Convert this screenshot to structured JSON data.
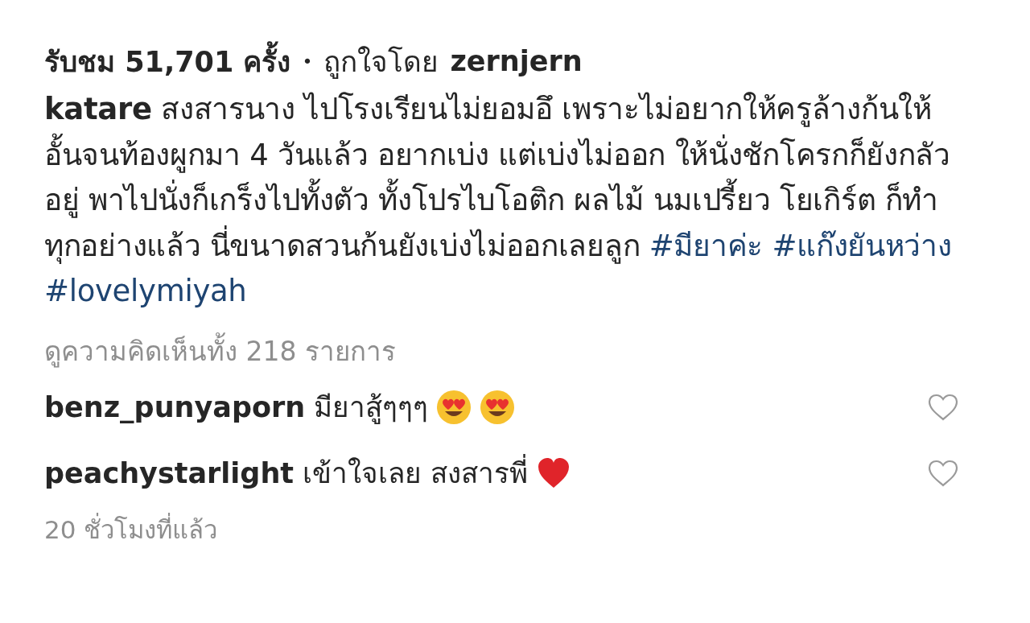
{
  "stats": {
    "views": "รับชม 51,701 ครั้ง",
    "separator": "•",
    "liked_by_label": "ถูกใจโดย",
    "liked_by_user": "zernjern"
  },
  "caption": {
    "username": "katare",
    "text": "สงสารนาง ไปโรงเรียนไม่ยอมอึ เพราะไม่อยากให้ครูล้างก้นให้ อั้นจนท้องผูกมา 4 วันแล้ว อยากเบ่ง แต่เบ่งไม่ออก ให้นั่งชักโครกก็ยังกลัวอยู่ พาไปนั่งก็เกร็งไปทั้งตัว ทั้งโปรไบโอติก ผลไม้ นมเปรี้ยว โยเกิร์ต ก็ทำทุกอย่างแล้ว นี่ขนาดสวนก้นยังเบ่งไม่ออกเลยลูก",
    "hashtags": [
      "#มียาค่ะ",
      "#แก๊งยันหว่าง",
      "#lovelymiyah"
    ]
  },
  "view_all_comments": "ดูความคิดเห็นทั้ง 218 รายการ",
  "comments": [
    {
      "username": "benz_punyaporn",
      "text": "มียาสู้ๆๆๆ",
      "emojis": [
        {
          "kind": "heart-eyes"
        },
        {
          "kind": "heart-eyes"
        }
      ],
      "liked": false
    },
    {
      "username": "peachystarlight",
      "text": "เข้าใจเลย สงสารพี่",
      "emojis": [
        {
          "kind": "red-heart"
        }
      ],
      "liked": false
    }
  ],
  "time": "20 ชั่วโมงที่แล้ว"
}
